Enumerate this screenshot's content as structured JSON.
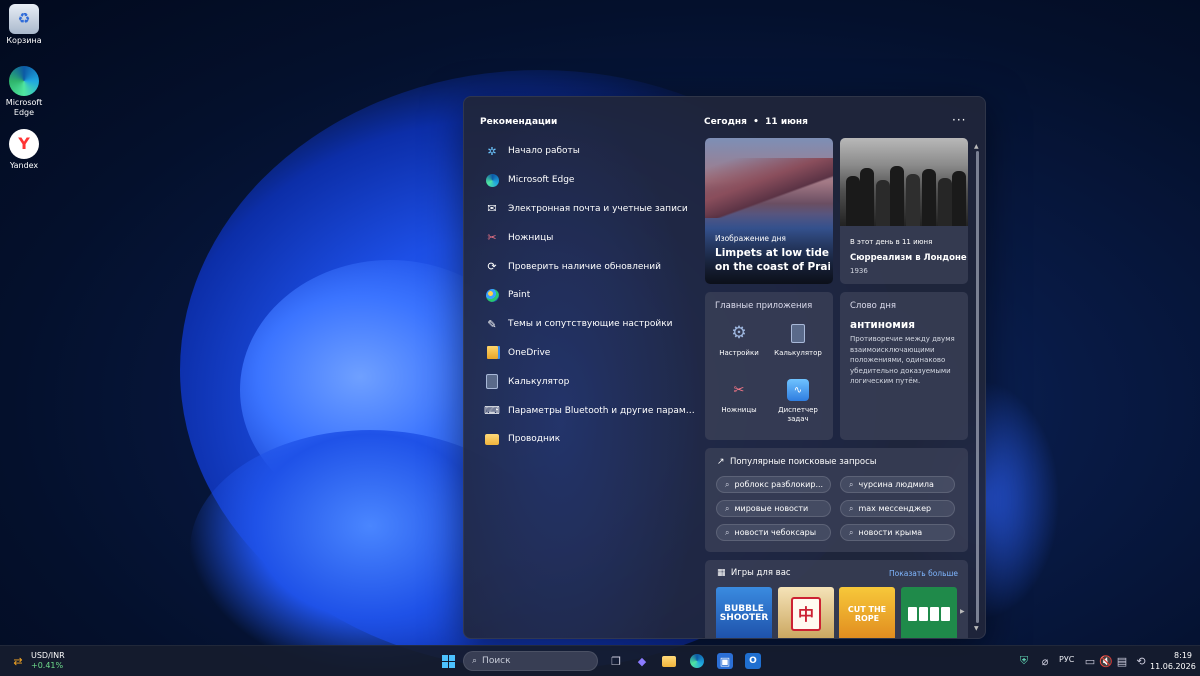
{
  "desktop": {
    "icons": [
      {
        "label": "Корзина",
        "icon": "recycle-bin-icon"
      },
      {
        "label": "Microsoft Edge",
        "icon": "edge-icon"
      },
      {
        "label": "Yandex",
        "icon": "yandex-icon"
      }
    ]
  },
  "widgets": {
    "recommendations_title": "Рекомендации",
    "recommendations": [
      {
        "label": "Начало работы",
        "icon": "getting-started-icon"
      },
      {
        "label": "Microsoft Edge",
        "icon": "edge-icon"
      },
      {
        "label": "Электронная почта и учетные записи",
        "icon": "mail-icon"
      },
      {
        "label": "Ножницы",
        "icon": "snipping-tool-icon"
      },
      {
        "label": "Проверить наличие обновлений",
        "icon": "update-icon"
      },
      {
        "label": "Paint",
        "icon": "paint-icon"
      },
      {
        "label": "Темы и сопутствующие настройки",
        "icon": "brush-icon"
      },
      {
        "label": "OneDrive",
        "icon": "onedrive-icon"
      },
      {
        "label": "Калькулятор",
        "icon": "calculator-icon"
      },
      {
        "label": "Параметры Bluetooth и другие параметры у...",
        "icon": "bluetooth-devices-icon"
      },
      {
        "label": "Проводник",
        "icon": "folder-icon"
      }
    ],
    "today_label": "Сегодня",
    "date": "11 июня",
    "photo_card": {
      "kicker": "Изображение дня",
      "headline_line1": "Limpets at low tide",
      "headline_line2": "on the coast of Prai..."
    },
    "history_card": {
      "kicker": "В этот день в 11 июня",
      "headline": "Сюрреализм в Лондоне",
      "year": "1936"
    },
    "top_apps": {
      "title": "Главные приложения",
      "apps": [
        {
          "label": "Настройки",
          "icon": "settings-gear-icon"
        },
        {
          "label": "Калькулятор",
          "icon": "calculator-icon"
        },
        {
          "label": "Ножницы",
          "icon": "snipping-tool-icon"
        },
        {
          "label": "Диспетчер задач",
          "icon": "task-manager-icon"
        }
      ]
    },
    "word_of_day": {
      "title": "Слово дня",
      "word": "антиномия",
      "definition": "Противоречие между двумя взаимоисключающими положениями, одинаково убедительно доказуемыми логическим путём."
    },
    "trending": {
      "title": "Популярные поисковые запросы",
      "queries": [
        "роблокс разблокир...",
        "чурсина людмила",
        "мировые новости",
        "max мессенджер",
        "новости чебоксары",
        "новости крыма"
      ]
    },
    "games": {
      "title": "Игры для вас",
      "show_more": "Показать больше",
      "items": [
        {
          "label": "BUBBLE SHOOTER",
          "icon": "bubble-shooter-icon"
        },
        {
          "label": "",
          "icon": "mahjong-icon"
        },
        {
          "label": "CUT THE ROPE",
          "icon": "cut-the-rope-icon"
        },
        {
          "label": "",
          "icon": "solitaire-icon"
        }
      ]
    }
  },
  "taskbar": {
    "weather_widget": {
      "title": "USD/INR",
      "change": "+0.41%"
    },
    "search_placeholder": "Поиск",
    "language": "РУС",
    "time": "8:19",
    "date": "11.06.2026",
    "accent": "#2f6bff"
  }
}
